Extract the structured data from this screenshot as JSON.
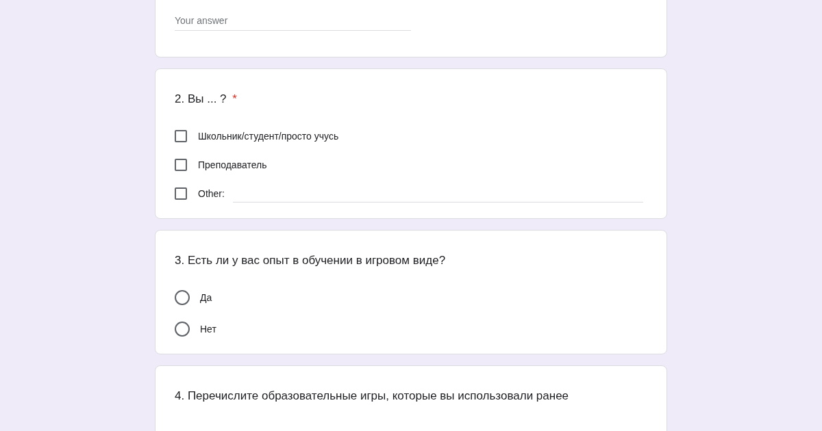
{
  "cards": [
    {
      "kind": "text",
      "answer": {
        "placeholder": "Your answer"
      }
    },
    {
      "kind": "checkbox",
      "title": "2. Вы ... ?",
      "required_mark": "*",
      "options": [
        {
          "kind": "plain",
          "label": "Школьник/студент/просто учусь",
          "checked": false
        },
        {
          "kind": "plain",
          "label": "Преподаватель",
          "checked": false
        },
        {
          "kind": "other",
          "label": "Other:",
          "checked": false
        }
      ]
    },
    {
      "kind": "radio",
      "title": "3. Есть ли у вас опыт в обучении в игровом виде?",
      "options": [
        {
          "label": "Да",
          "selected": false
        },
        {
          "label": "Нет",
          "selected": false
        }
      ]
    },
    {
      "kind": "title_only",
      "title": "4. Перечислите образовательные игры, которые вы использовали ранее"
    }
  ]
}
